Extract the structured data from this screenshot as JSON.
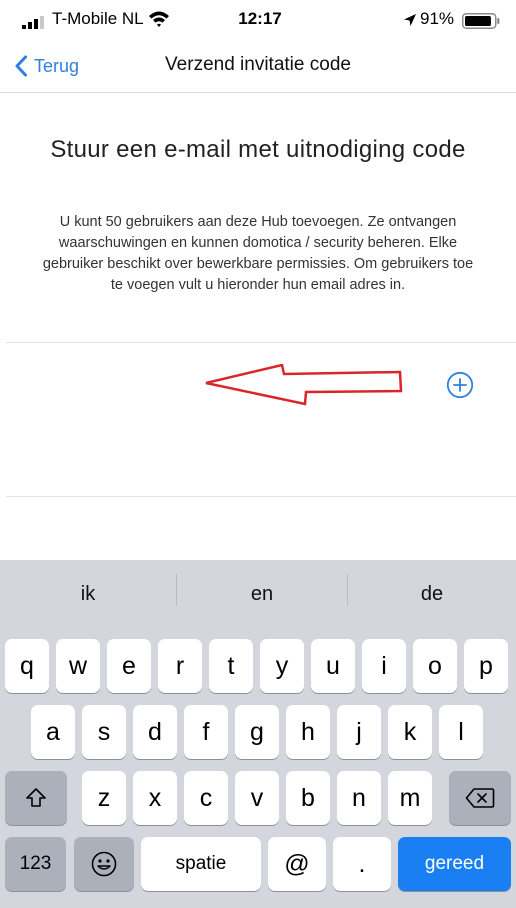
{
  "status_bar": {
    "carrier": "T-Mobile NL",
    "time": "12:17",
    "battery_percent": "91%",
    "battery_level": 0.91
  },
  "nav": {
    "back_label": "Terug",
    "title": "Verzend invitatie code"
  },
  "content": {
    "headline": "Stuur een e-mail met uitnodiging code",
    "description": "U kunt 50 gebruikers aan deze Hub toevoegen. Ze ontvangen waarschuwingen en kunnen domotica / security beheren. Elke gebruiker beschikt over bewerkbare permissies. Om gebruikers toe te voegen vult u hieronder hun email adres in.",
    "email_value": "",
    "add_icon": "plus-circle-icon",
    "annotation": "red-arrow-left"
  },
  "colors": {
    "accent": "#2f7fe0",
    "annotation": "#d9262a",
    "keyboard_bg": "#d3d6dc",
    "return_key": "#1b7ff4"
  },
  "keyboard": {
    "suggestions": [
      "ik",
      "en",
      "de"
    ],
    "row1": [
      "q",
      "w",
      "e",
      "r",
      "t",
      "y",
      "u",
      "i",
      "o",
      "p"
    ],
    "row2": [
      "a",
      "s",
      "d",
      "f",
      "g",
      "h",
      "j",
      "k",
      "l"
    ],
    "row3": [
      "z",
      "x",
      "c",
      "v",
      "b",
      "n",
      "m"
    ],
    "numbers_key": "123",
    "emoji_icon": "emoji-icon",
    "shift_icon": "shift-icon",
    "delete_icon": "delete-icon",
    "space_label": "spatie",
    "at_label": "@",
    "period_label": ".",
    "return_label": "gereed"
  }
}
